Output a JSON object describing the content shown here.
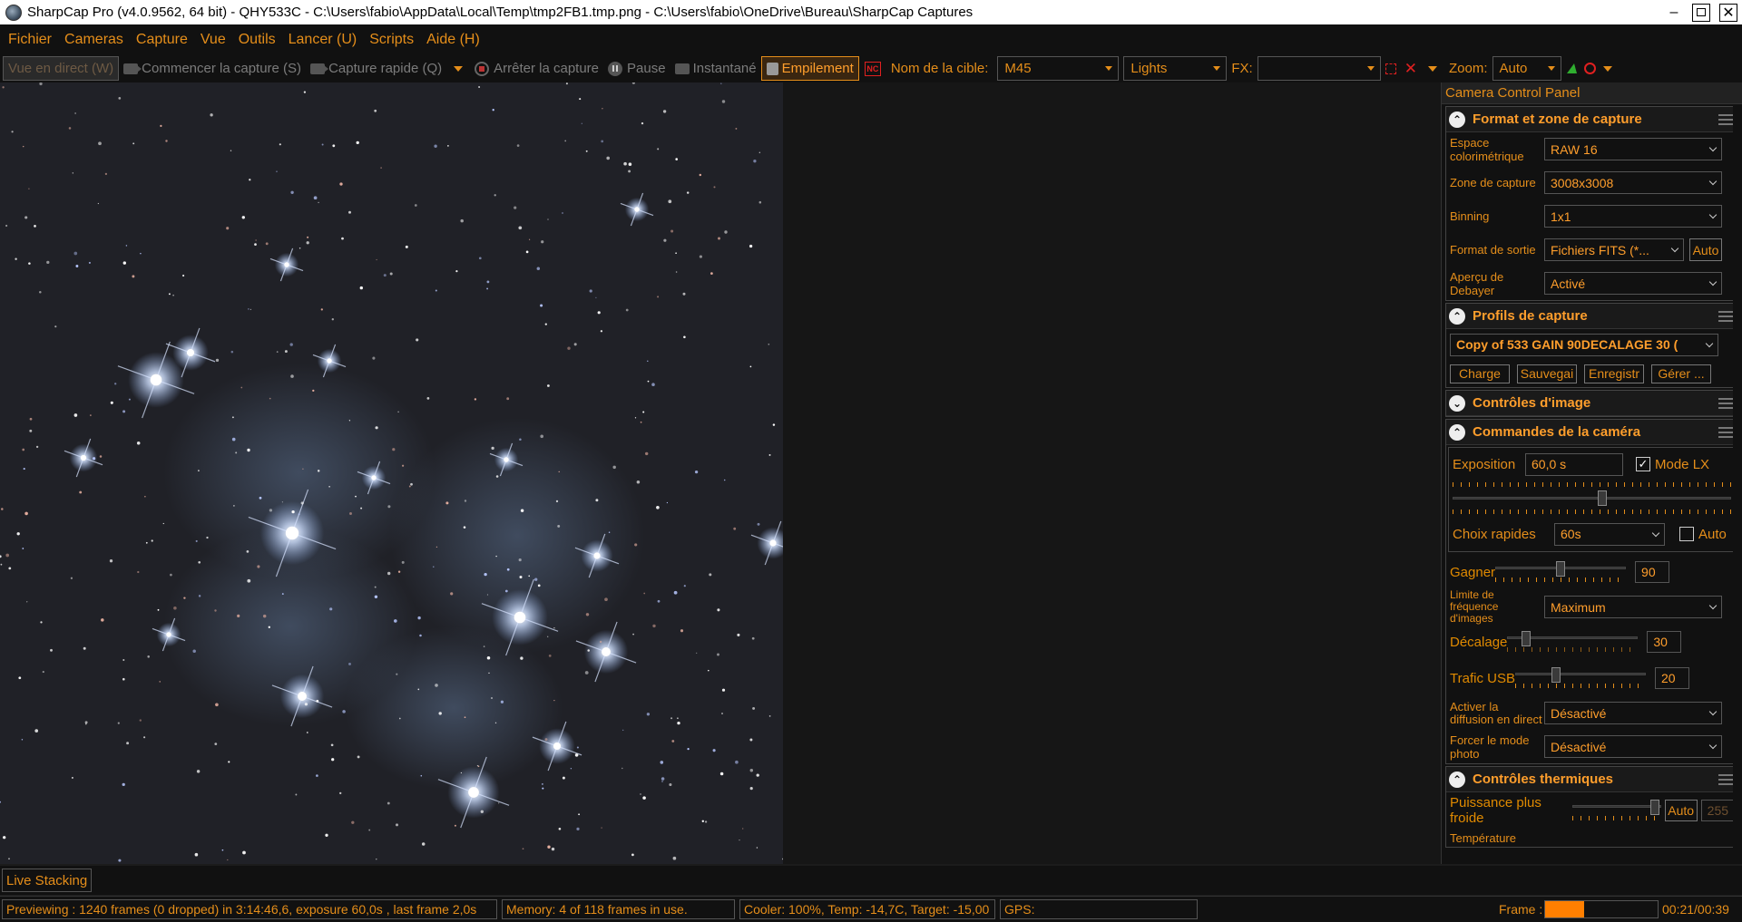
{
  "window": {
    "title": "SharpCap Pro (v4.0.9562, 64 bit) - QHY533C - C:\\Users\\fabio\\AppData\\Local\\Temp\\tmp2FB1.tmp.png - C:\\Users\\fabio\\OneDrive\\Bureau\\SharpCap Captures",
    "minimize": "–",
    "close": "✕"
  },
  "menu": [
    "Fichier",
    "Cameras",
    "Capture",
    "Vue",
    "Outils",
    "Lancer (U)",
    "Scripts",
    "Aide (H)"
  ],
  "toolbar": {
    "live_view": "Vue en direct (W)",
    "start_capture": "Commencer la capture (S)",
    "quick_capture": "Capture rapide (Q)",
    "stop_capture": "Arrêter la capture",
    "pause": "Pause",
    "snapshot": "Instantané",
    "stacking": "Empilement",
    "nc_icon": "NC",
    "target_label": "Nom de la cible:",
    "target_value": "M45",
    "frame_type": "Lights",
    "fx_label": "FX:",
    "fx_value": "",
    "zoom_label": "Zoom:",
    "zoom_value": "Auto"
  },
  "panel": {
    "title": "Camera Control Panel",
    "format": {
      "title": "Format et zone de capture",
      "color_space_label": "Espace colorimétrique",
      "color_space": "RAW 16",
      "capture_area_label": "Zone de capture",
      "capture_area": "3008x3008",
      "binning_label": "Binning",
      "binning": "1x1",
      "output_label": "Format de sortie",
      "output": "Fichiers FITS (*...",
      "output_auto": "Auto",
      "debayer_label": "Aperçu de Debayer",
      "debayer": "Activé"
    },
    "profiles": {
      "title": "Profils de capture",
      "selected": "Copy of 533 GAIN 90DECALAGE 30 (",
      "load": "Charge",
      "save": "Sauvegai",
      "save_as": "Enregistr",
      "manage": "Gérer ..."
    },
    "image_controls": {
      "title": "Contrôles d'image"
    },
    "camera": {
      "title": "Commandes de la caméra",
      "exposure_label": "Exposition",
      "exposure": "60,0 s",
      "lx_mode": "Mode LX",
      "lx_check": "✓",
      "exposure_level": 0.54,
      "quick_label": "Choix rapides",
      "quick": "60s",
      "quick_auto": "Auto",
      "gain_label": "Gagner",
      "gain": "90",
      "gain_level": 0.5,
      "framerate_label": "Limite de fréquence d'images",
      "framerate": "Maximum",
      "offset_label": "Décalage",
      "offset": "30",
      "offset_level": 0.12,
      "usb_label": "Trafic USB",
      "usb": "20",
      "usb_level": 0.3,
      "stream_label": "Activer la diffusion en direct",
      "stream": "Désactivé",
      "photo_label": "Forcer le mode photo",
      "photo": "Désactivé"
    },
    "thermal": {
      "title": "Contrôles thermiques",
      "cooler_label": "Puissance plus froide",
      "cooler_auto": "Auto",
      "cooler_value": "255",
      "cooler_level": 0.98,
      "temp_label": "Température"
    }
  },
  "bottom_tab": "Live Stacking",
  "status": {
    "preview": "Previewing : 1240 frames (0 dropped) in 3:14:46,6, exposure 60,0s , last frame 2,0s",
    "memory": "Memory: 4 of 118 frames in use.",
    "cooler": "Cooler: 100%, Temp: -14,7C, Target: -15,00",
    "gps": "GPS:",
    "frame_label": "Frame :",
    "frame_progress": 0.35,
    "frame_time": "00:21/00:39"
  },
  "colors": {
    "accent": "#e58e1a",
    "background": "#111111",
    "sky": "#1f2025"
  }
}
